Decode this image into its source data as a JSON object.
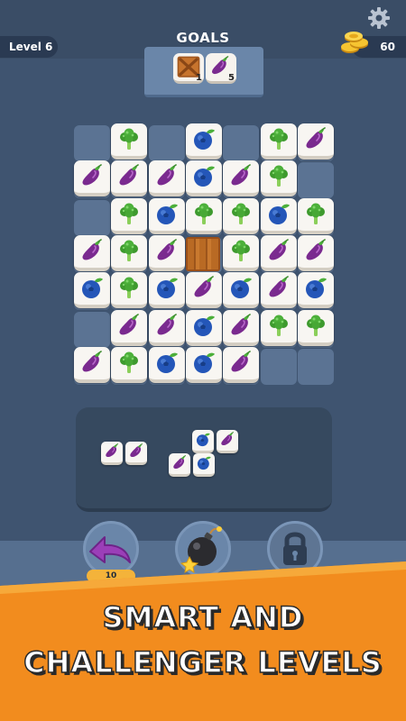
{
  "header": {
    "level_label": "Level 6",
    "goals_title": "GOALS",
    "coins": "60"
  },
  "goals": [
    {
      "icon": "crate-icon",
      "count": "1"
    },
    {
      "icon": "eggplant-icon",
      "count": "5"
    }
  ],
  "board": {
    "rows": [
      [
        "empty",
        "broccoli",
        "empty",
        "blueberry",
        "empty",
        "broccoli",
        "eggplant"
      ],
      [
        "eggplant",
        "eggplant",
        "eggplant",
        "blueberry",
        "eggplant",
        "broccoli",
        "empty"
      ],
      [
        "empty",
        "broccoli",
        "blueberry",
        "broccoli",
        "broccoli",
        "blueberry",
        "broccoli"
      ],
      [
        "eggplant",
        "broccoli",
        "eggplant",
        "crate",
        "broccoli",
        "eggplant",
        "eggplant"
      ],
      [
        "blueberry",
        "broccoli",
        "blueberry",
        "eggplant",
        "blueberry",
        "eggplant",
        "blueberry"
      ],
      [
        "empty",
        "eggplant",
        "eggplant",
        "blueberry",
        "eggplant",
        "broccoli",
        "broccoli"
      ],
      [
        "eggplant",
        "broccoli",
        "blueberry",
        "blueberry",
        "eggplant",
        "empty",
        "empty"
      ]
    ]
  },
  "tray": {
    "pieces": [
      {
        "name": "piece-1",
        "tiles": [
          "eggplant",
          "eggplant"
        ]
      },
      {
        "name": "piece-2",
        "tiles": [
          "blueberry",
          "eggplant",
          "eggplant",
          "blueberry"
        ]
      }
    ]
  },
  "actions": {
    "undo_badge": "10",
    "icons": [
      "undo-arrow-icon",
      "bomb-icon",
      "lock-icon"
    ]
  },
  "banner": {
    "line1": "SMART AND",
    "line2": "CHALLENGER LEVELS"
  },
  "colors": {
    "background": "#3f5470",
    "banner_orange": "#f28c1e",
    "tile_face": "#f8f6f2"
  }
}
